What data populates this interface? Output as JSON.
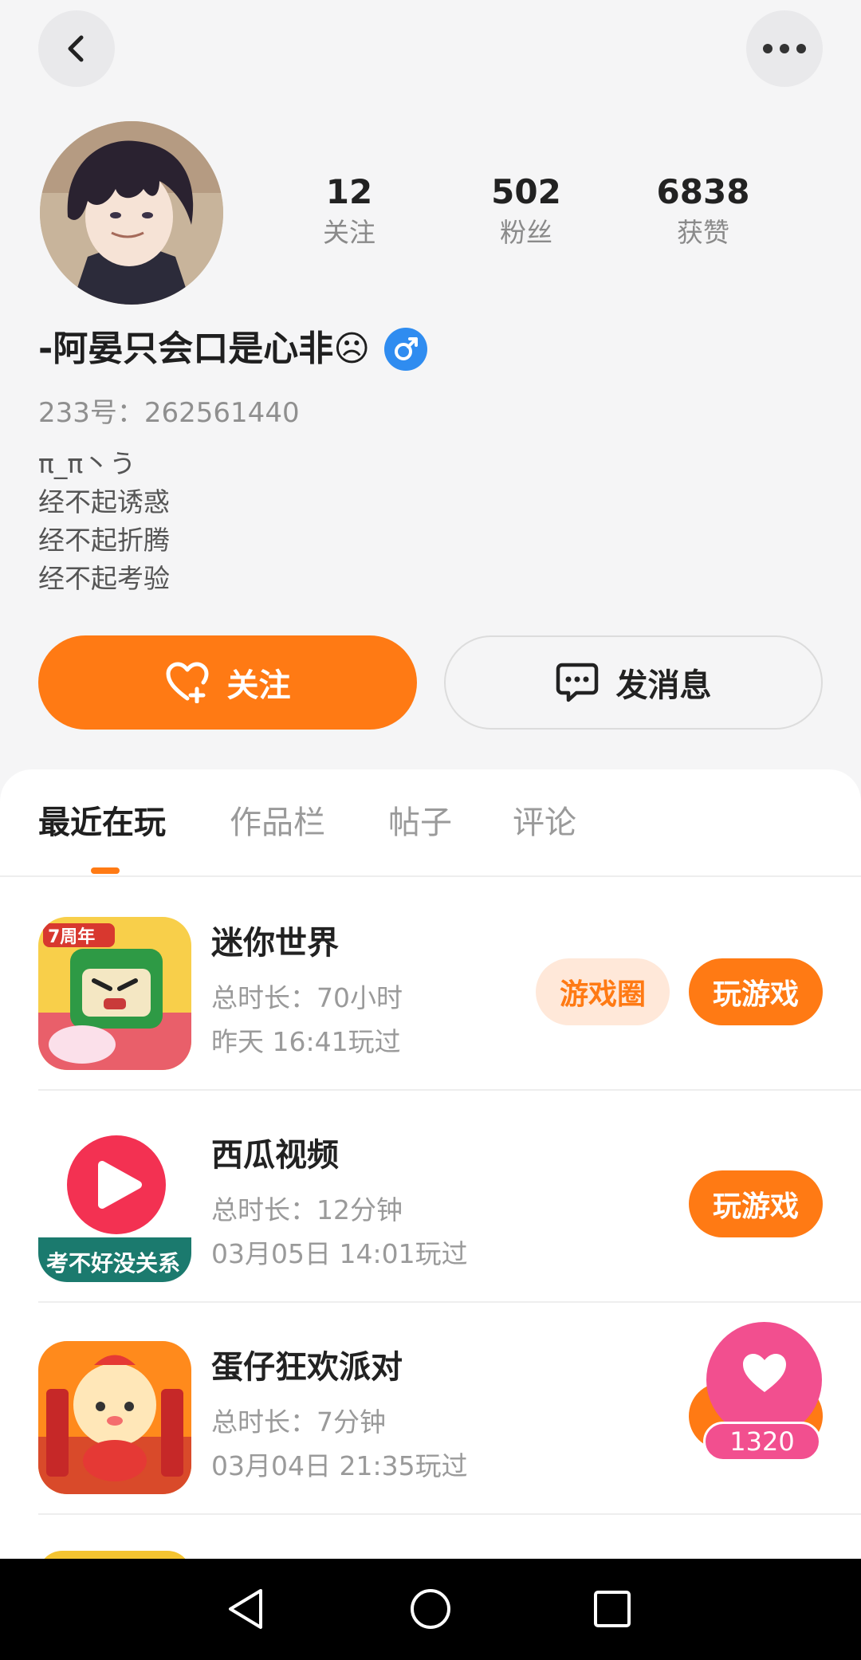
{
  "header": {
    "back_icon": "chevron-left-icon",
    "more_icon": "more-horizontal-icon"
  },
  "profile": {
    "stats": [
      {
        "value": "12",
        "label": "关注"
      },
      {
        "value": "502",
        "label": "粉丝"
      },
      {
        "value": "6838",
        "label": "获赞"
      }
    ],
    "name": "-阿晏只会口是心非☹",
    "gender_icon": "male-symbol-icon",
    "uid": "233号：262561440",
    "bio": [
      "π_π丶う",
      "经不起诱惑",
      "经不起折腾",
      "经不起考验"
    ]
  },
  "actions": {
    "follow_label": "关注",
    "message_label": "发消息"
  },
  "tabs": [
    {
      "label": "最近在玩",
      "active": true
    },
    {
      "label": "作品栏",
      "active": false
    },
    {
      "label": "帖子",
      "active": false
    },
    {
      "label": "评论",
      "active": false
    }
  ],
  "games": [
    {
      "title": "迷你世界",
      "duration": "总时长：70小时",
      "last_played": "昨天 16:41玩过",
      "circle_label": "游戏圈",
      "play_label": "玩游戏",
      "icon_text": "7周年"
    },
    {
      "title": "西瓜视频",
      "duration": "总时长：12分钟",
      "last_played": "03月05日 14:01玩过",
      "play_label": "玩游戏",
      "icon_text": "考不好没关系"
    },
    {
      "title": "蛋仔狂欢派对",
      "duration": "总时长：7分钟",
      "last_played": "03月04日 21:35玩过"
    }
  ],
  "floating_like": {
    "count": "1320",
    "icon": "heart-icon"
  },
  "colors": {
    "accent": "#ff7a14",
    "pink": "#f24f8f",
    "gender_blue": "#2f8cf0"
  },
  "system_nav": {
    "back_icon": "triangle-back-icon",
    "home_icon": "circle-home-icon",
    "recents_icon": "square-recents-icon"
  }
}
